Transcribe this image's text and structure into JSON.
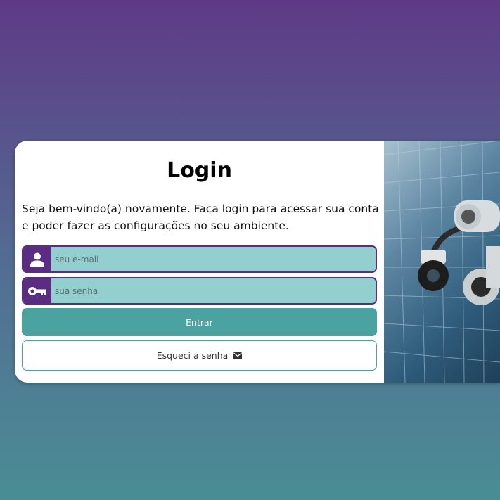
{
  "login": {
    "title": "Login",
    "subtitle": "Seja bem-vindo(a) novamente. Faça login para acessar sua conta e poder fazer as configurações no seu ambiente.",
    "email_placeholder": "seu e-mail",
    "password_placeholder": "sua senha",
    "submit_label": "Entrar",
    "forgot_label": "Esqueci a senha"
  },
  "icons": {
    "email_field": "user-icon",
    "password_field": "key-icon",
    "forgot": "envelope-icon"
  },
  "colors": {
    "accent_purple": "#5b2d82",
    "input_bg": "#94cfcf",
    "button_teal": "#4aa3a0"
  }
}
